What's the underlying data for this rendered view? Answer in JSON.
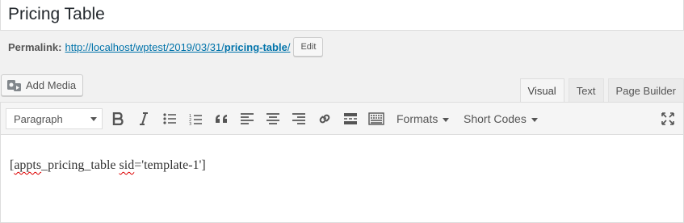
{
  "post": {
    "title": "Pricing Table"
  },
  "permalink": {
    "label": "Permalink:",
    "url_base": "http://localhost/wptest/2019/03/31/",
    "url_slug": "pricing-table",
    "url_tail": "/",
    "edit_label": "Edit"
  },
  "media": {
    "add_label": "Add Media",
    "icon": "add-media-icon"
  },
  "tabs": [
    {
      "label": "Visual",
      "active": true
    },
    {
      "label": "Text",
      "active": false
    },
    {
      "label": "Page Builder",
      "active": false
    }
  ],
  "toolbar": {
    "format_value": "Paragraph",
    "formats_label": "Formats",
    "shortcodes_label": "Short Codes",
    "icons": [
      "bold-icon",
      "italic-icon",
      "bullet-list-icon",
      "numbered-list-icon",
      "blockquote-icon",
      "align-left-icon",
      "align-center-icon",
      "align-right-icon",
      "link-icon",
      "read-more-icon",
      "toolbar-toggle-icon",
      "fullscreen-icon"
    ]
  },
  "content": {
    "part1": "[",
    "word1": "appts",
    "part2": "_pricing_table ",
    "word2": "sid",
    "part3": "='template-1']"
  }
}
